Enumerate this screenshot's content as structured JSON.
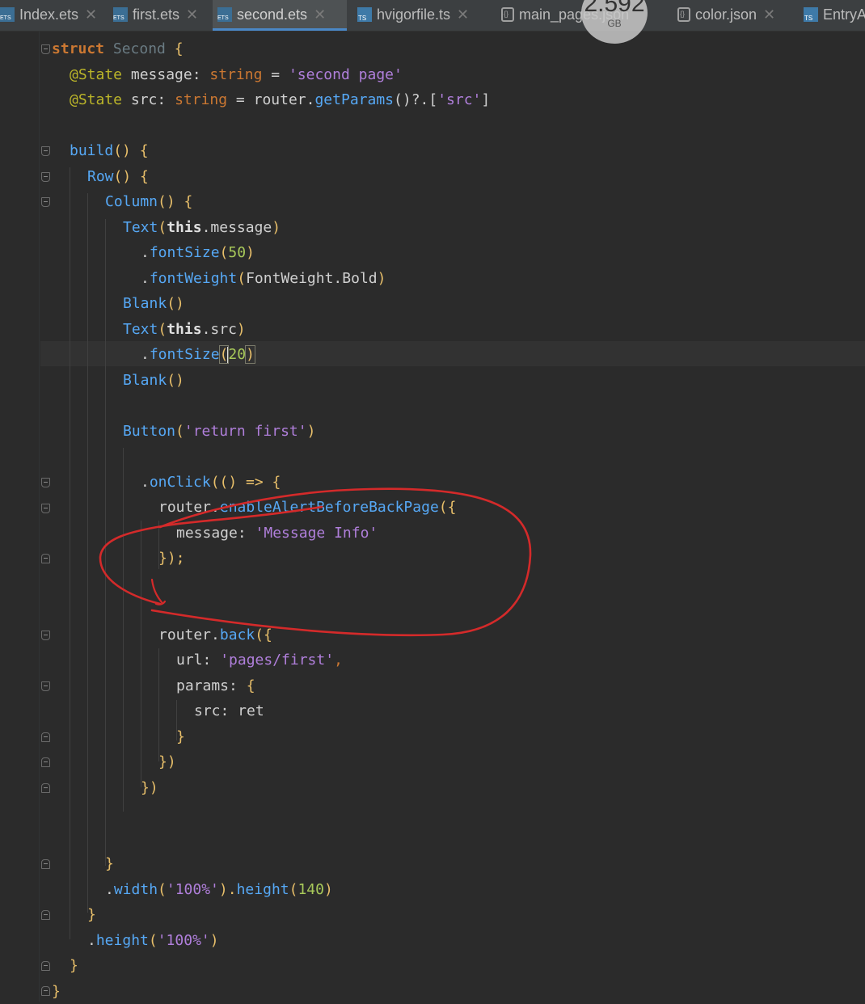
{
  "tabs": [
    {
      "label": "Index.ets",
      "icon": "ets"
    },
    {
      "label": "first.ets",
      "icon": "ets"
    },
    {
      "label": "second.ets",
      "icon": "ets"
    },
    {
      "label": "hvigorfile.ts",
      "icon": "ts"
    },
    {
      "label": "main_pages.json",
      "icon": "json"
    },
    {
      "label": "color.json",
      "icon": "json"
    },
    {
      "label": "EntryA",
      "icon": "ts"
    }
  ],
  "active_tab": "second.ets",
  "close_glyph": "✕",
  "overlay": {
    "value": "2.592",
    "unit": "GB"
  },
  "code": {
    "l1": {
      "a": "struct",
      "b": " ",
      "c": "Second",
      "d": " {"
    },
    "l2": {
      "a": "@State",
      "b": " message: ",
      "c": "string",
      "d": " = ",
      "e": "'second page'"
    },
    "l3": {
      "a": "@State",
      "b": " src: ",
      "c": "string",
      "d": " = router.",
      "e": "getParams",
      "f": "()?.[",
      "g": "'src'",
      "h": "]"
    },
    "l5": {
      "a": "build",
      "b": "() {"
    },
    "l6": {
      "a": "Row",
      "b": "() {"
    },
    "l7": {
      "a": "Column",
      "b": "() {"
    },
    "l8": {
      "a": "Text",
      "b": "(",
      "c": "this",
      "d": ".message",
      "e": ")"
    },
    "l9": {
      "a": ".",
      "b": "fontSize",
      "c": "(",
      "d": "50",
      "e": ")"
    },
    "l10": {
      "a": ".",
      "b": "fontWeight",
      "c": "(",
      "d": "FontWeight.Bold",
      "e": ")"
    },
    "l11": {
      "a": "Blank",
      "b": "()"
    },
    "l12": {
      "a": "Text",
      "b": "(",
      "c": "this",
      "d": ".src",
      "e": ")"
    },
    "l13": {
      "a": ".",
      "b": "fontSize",
      "c": "(",
      "d": "20",
      "e": ")"
    },
    "l14": {
      "a": "Blank",
      "b": "()"
    },
    "l16": {
      "a": "Button",
      "b": "(",
      "c": "'return first'",
      "d": ")"
    },
    "l18": {
      "a": ".",
      "b": "onClick",
      "c": "(() => {"
    },
    "l19": {
      "a": "router.",
      "b": "enableAlertBeforeBackPage",
      "c": "({"
    },
    "l20": {
      "a": "message: ",
      "b": "'Message Info'"
    },
    "l21": {
      "a": "});"
    },
    "l24": {
      "a": "router.",
      "b": "back",
      "c": "({"
    },
    "l25": {
      "a": "url: ",
      "b": "'pages/first'",
      "c": ","
    },
    "l26": {
      "a": "params: ",
      "b": "{"
    },
    "l27": {
      "a": "src: ret"
    },
    "l28": {
      "a": "}"
    },
    "l29": {
      "a": "})"
    },
    "l30": {
      "a": "})"
    },
    "l34": {
      "a": "}"
    },
    "l35": {
      "a": ".",
      "b": "width",
      "c": "(",
      "d": "'100%'",
      "e": ").",
      "f": "height",
      "g": "(",
      "h": "140",
      "i": ")"
    },
    "l36": {
      "a": "}"
    },
    "l37": {
      "a": ".",
      "b": "height",
      "c": "(",
      "d": "'100%'",
      "e": ")"
    },
    "l38": {
      "a": "}"
    },
    "l39": {
      "a": "}"
    }
  }
}
